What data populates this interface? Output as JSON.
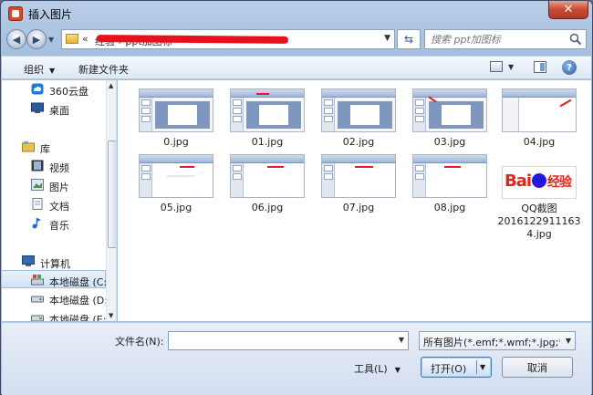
{
  "window": {
    "title": "插入图片",
    "close_glyph": "✕"
  },
  "address": {
    "chevron": "«",
    "path_visible": "经验 ›  ppt加图标",
    "dropdown": "▼"
  },
  "search": {
    "placeholder": "搜索 ppt加图标"
  },
  "toolbar": {
    "organize": "组织",
    "new_folder": "新建文件夹",
    "help": "?"
  },
  "nav": {
    "items": [
      {
        "label": "360云盘",
        "icon": "cloud-drive-icon",
        "type": "item"
      },
      {
        "label": "桌面",
        "icon": "desktop-icon",
        "type": "item"
      },
      {
        "label": "库",
        "icon": "library-icon",
        "type": "group"
      },
      {
        "label": "视频",
        "icon": "video-icon",
        "type": "item"
      },
      {
        "label": "图片",
        "icon": "pictures-icon",
        "type": "item"
      },
      {
        "label": "文档",
        "icon": "documents-icon",
        "type": "item"
      },
      {
        "label": "音乐",
        "icon": "music-icon",
        "type": "item"
      },
      {
        "label": "计算机",
        "icon": "computer-icon",
        "type": "group"
      },
      {
        "label": "本地磁盘 (C:",
        "icon": "drive-c-icon",
        "type": "item",
        "selected": true
      },
      {
        "label": "本地磁盘 (D:",
        "icon": "drive-icon",
        "type": "item"
      },
      {
        "label": "本地磁盘 (E:",
        "icon": "drive-icon",
        "type": "item"
      }
    ]
  },
  "files": [
    {
      "name": "0.jpg"
    },
    {
      "name": "01.jpg"
    },
    {
      "name": "02.jpg"
    },
    {
      "name": "03.jpg"
    },
    {
      "name": "04.jpg"
    },
    {
      "name": "05.jpg"
    },
    {
      "name": "06.jpg"
    },
    {
      "name": "07.jpg"
    },
    {
      "name": "08.jpg"
    },
    {
      "name": "QQ截图20161229111634.jpg",
      "display": "QQ截图\n2016122911163\n4.jpg"
    }
  ],
  "baidu_logo": {
    "part1": "Bai",
    "part2": "经验"
  },
  "bottom": {
    "filename_label": "文件名(N):",
    "filename_value": "",
    "filetype": "所有图片(*.emf;*.wmf;*.jpg;*.jp",
    "tools": "工具(L)",
    "open": "打开(O)",
    "cancel": "取消"
  },
  "colors": {
    "accent": "#3c7fb1",
    "title_bar": "#b9cde6",
    "close": "#c74a35"
  }
}
